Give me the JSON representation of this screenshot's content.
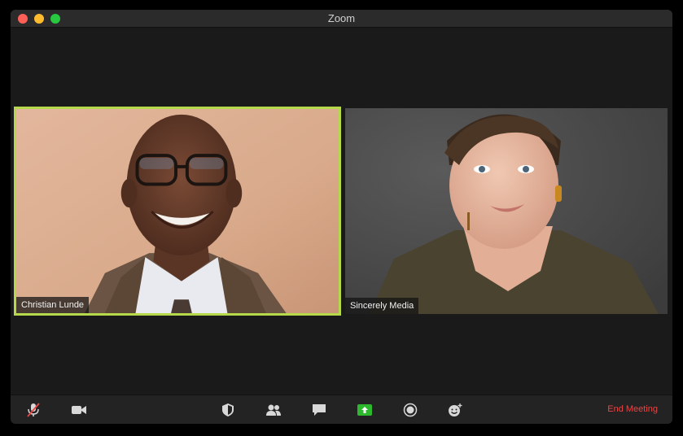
{
  "window": {
    "title": "Zoom"
  },
  "participants": [
    {
      "name": "Christian Lunde",
      "active_speaker": true
    },
    {
      "name": "Sincerely Media",
      "active_speaker": false
    }
  ],
  "toolbar": {
    "buttons": [
      {
        "id": "mute",
        "icon": "microphone-muted-icon"
      },
      {
        "id": "video",
        "icon": "video-camera-icon"
      },
      {
        "id": "security",
        "icon": "shield-icon"
      },
      {
        "id": "participants",
        "icon": "participants-icon"
      },
      {
        "id": "chat",
        "icon": "chat-bubble-icon"
      },
      {
        "id": "share-screen",
        "icon": "share-screen-icon"
      },
      {
        "id": "record",
        "icon": "record-icon"
      },
      {
        "id": "reactions",
        "icon": "emoji-icon"
      }
    ],
    "end_meeting_label": "End Meeting"
  },
  "colors": {
    "active_speaker_border": "#b6d94c",
    "share_screen_green": "#2eb82e",
    "end_meeting": "#e84545"
  }
}
